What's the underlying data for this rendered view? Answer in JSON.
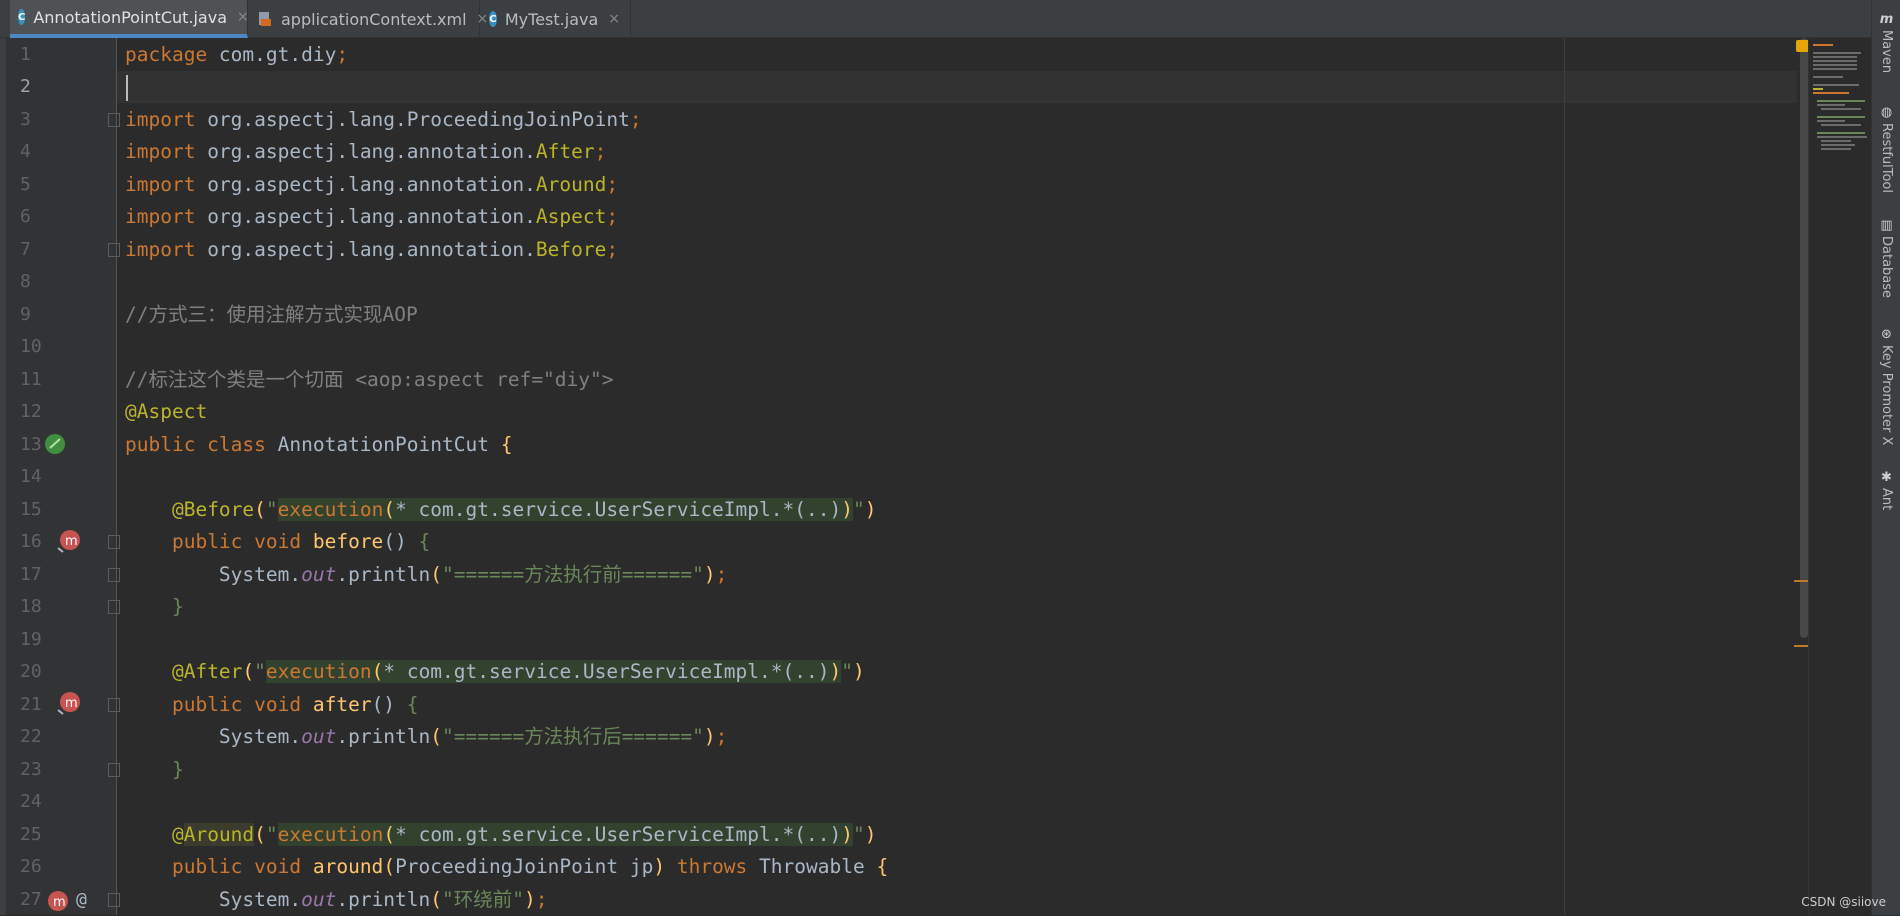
{
  "tabs": [
    {
      "label": "AnnotationPointCut.java",
      "icon": "java-class-icon",
      "active": true
    },
    {
      "label": "applicationContext.xml",
      "icon": "xml-file-icon",
      "active": false
    },
    {
      "label": "MyTest.java",
      "icon": "java-class-icon",
      "active": false
    }
  ],
  "close_glyph": "×",
  "line_numbers": [
    "1",
    "2",
    "3",
    "4",
    "5",
    "6",
    "7",
    "8",
    "9",
    "10",
    "11",
    "12",
    "13",
    "14",
    "15",
    "16",
    "17",
    "18",
    "19",
    "20",
    "21",
    "22",
    "23",
    "24",
    "25",
    "26",
    "27"
  ],
  "tool_windows": [
    {
      "label": "Maven",
      "glyph": "m"
    },
    {
      "label": "RestfulTool",
      "glyph": "◍"
    },
    {
      "label": "Database",
      "glyph": "▥"
    },
    {
      "label": "Key Promoter X",
      "glyph": "⊛"
    },
    {
      "label": "Ant",
      "glyph": "✱"
    }
  ],
  "gutter_at": "@",
  "watermark": "CSDN @siiove",
  "colors": {
    "keyword": "#cc7832",
    "annotation": "#bbb529",
    "string": "#6a8759",
    "comment": "#808080",
    "method": "#ffc66d",
    "accent": "#4a88c7"
  }
}
